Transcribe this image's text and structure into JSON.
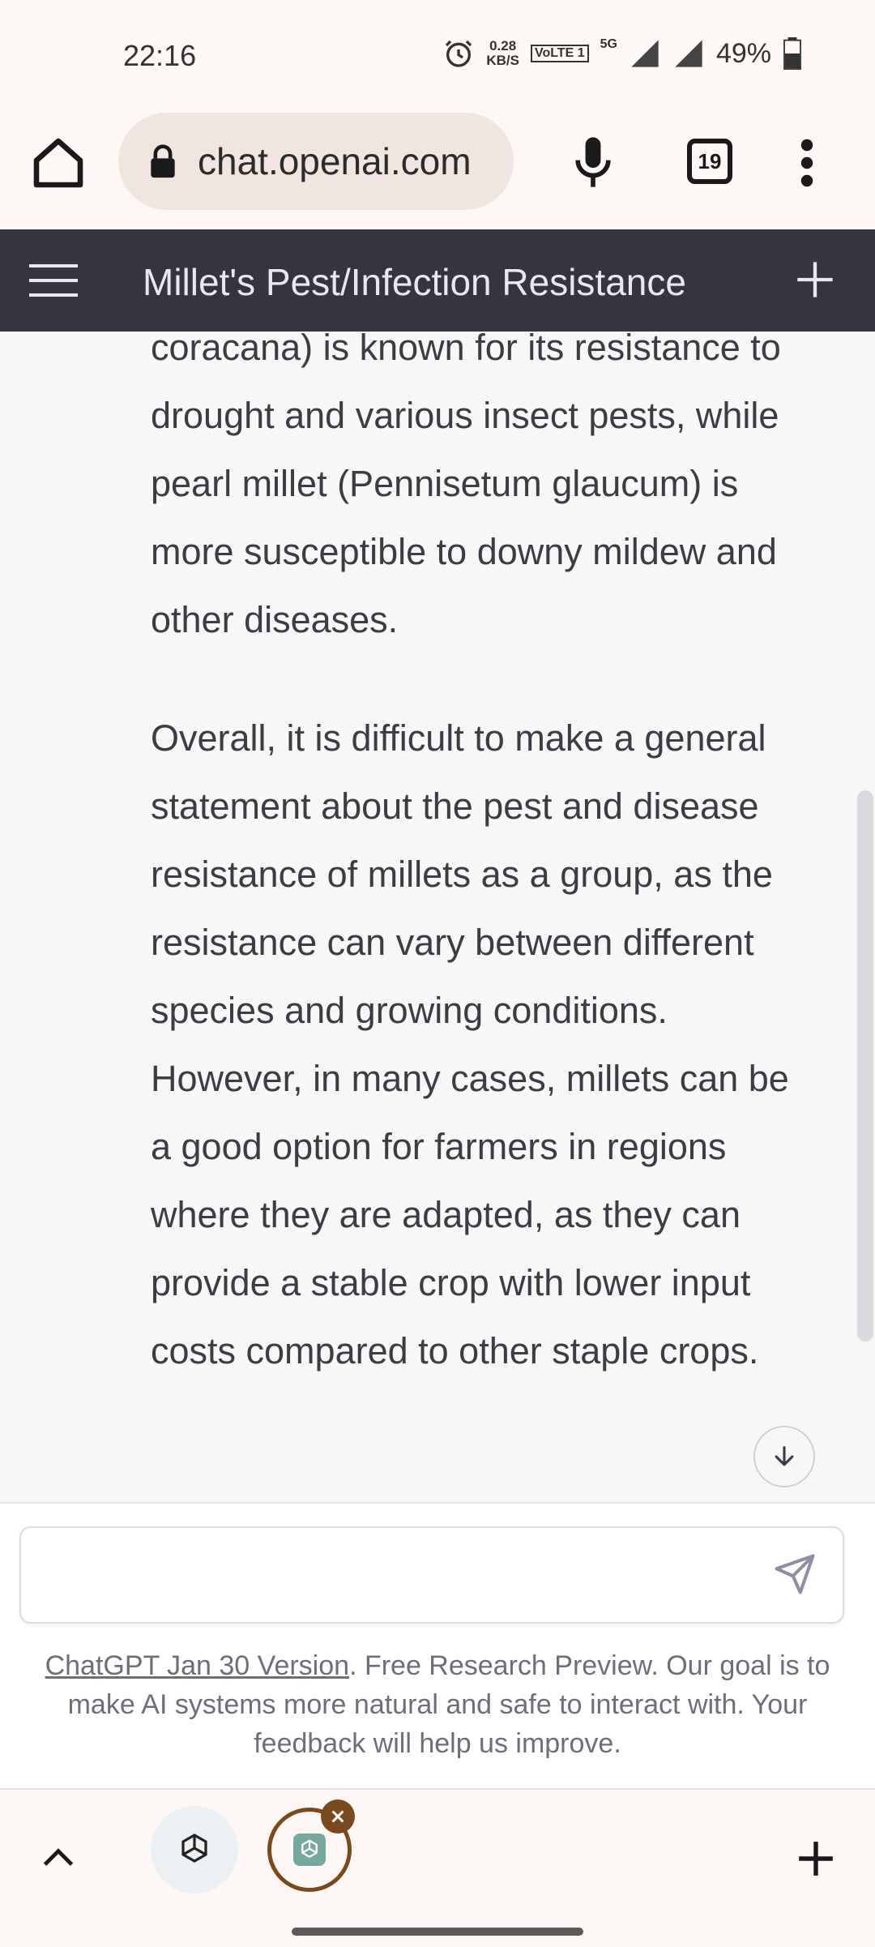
{
  "status_bar": {
    "time": "22:16",
    "net_speed_value": "0.28",
    "net_speed_unit": "KB/S",
    "volte": "VoLTE 1",
    "network": "5G",
    "battery": "49%"
  },
  "browser": {
    "url": "chat.openai.com",
    "tab_count": "19"
  },
  "header": {
    "title": "Millet's Pest/Infection Resistance"
  },
  "conversation": {
    "paragraphs": [
      "coracana) is known for its resistance to drought and various insect pests, while pearl millet (Pennisetum glaucum) is more susceptible to downy mildew and other diseases.",
      "Overall, it is difficult to make a general statement about the pest and disease resistance of millets as a group, as the resistance can vary between different species and growing conditions. However, in many cases, millets can be a good option for farmers in regions where they are adapted, as they can provide a stable crop with lower input costs compared to other staple crops."
    ]
  },
  "composer": {
    "placeholder": ""
  },
  "footer": {
    "link_text": "ChatGPT Jan 30 Version",
    "text": ". Free Research Preview. Our goal is to make AI systems more natural and safe to interact with. Your feedback will help us improve."
  },
  "icons": {
    "home": "home-icon",
    "lock": "lock-icon",
    "mic": "mic-icon",
    "menu": "more-vert-icon",
    "hamburger": "hamburger-icon",
    "new_chat": "plus-icon",
    "send": "send-icon",
    "scroll_down": "arrow-down-icon"
  },
  "colors": {
    "header_bg": "#343541",
    "content_bg": "#f7f7f8",
    "browser_bg": "#fdf8f5",
    "active_tab_ring": "#7a4a1c"
  }
}
